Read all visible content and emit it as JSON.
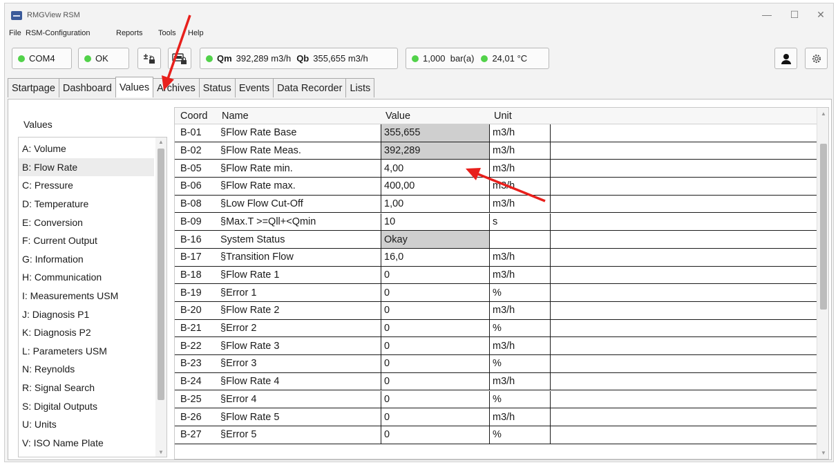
{
  "window": {
    "title": "RMGView RSM"
  },
  "menu": [
    "File",
    "RSM-Configuration",
    "Reports",
    "Tools",
    "Help"
  ],
  "toolbar": {
    "port": "COM4",
    "status": "OK",
    "qm_label": "Qm",
    "qm_value": "392,289 m3/h",
    "qb_label": "Qb",
    "qb_value": "355,655 m3/h",
    "pressure": "1,000  bar(a)",
    "temperature": "24,01 °C",
    "status_color": "#52d24a"
  },
  "tabs": [
    "Startpage",
    "Dashboard",
    "Values",
    "Archives",
    "Status",
    "Events",
    "Data Recorder",
    "Lists"
  ],
  "active_tab": "Values",
  "sidebar": {
    "title": "Values",
    "selected": "B: Flow Rate",
    "items": [
      "A: Volume",
      "B: Flow Rate",
      "C: Pressure",
      "D: Temperature",
      "E: Conversion",
      "F: Current Output",
      "G: Information",
      "H: Communication",
      "I: Measurements USM",
      "J: Diagnosis P1",
      "K: Diagnosis P2",
      "L: Parameters USM",
      "N: Reynolds",
      "R: Signal Search",
      "S: Digital Outputs",
      "U: Units",
      "V: ISO Name Plate"
    ]
  },
  "table": {
    "headers": {
      "coord": "Coord",
      "name": "Name",
      "value": "Value",
      "unit": "Unit"
    },
    "rows": [
      {
        "coord": "B-01",
        "name": "§Flow Rate Base",
        "value": "355,655",
        "unit": "m3/h",
        "readonly": true
      },
      {
        "coord": "B-02",
        "name": "§Flow Rate Meas.",
        "value": "392,289",
        "unit": "m3/h",
        "readonly": true
      },
      {
        "coord": "B-05",
        "name": "§Flow Rate min.",
        "value": "4,00",
        "unit": "m3/h",
        "readonly": false
      },
      {
        "coord": "B-06",
        "name": "§Flow Rate max.",
        "value": "400,00",
        "unit": "m3/h",
        "readonly": false
      },
      {
        "coord": "B-08",
        "name": "§Low Flow Cut-Off",
        "value": "1,00",
        "unit": "m3/h",
        "readonly": false
      },
      {
        "coord": "B-09",
        "name": "§Max.T >=Qll+<Qmin",
        "value": "10",
        "unit": "s",
        "readonly": false
      },
      {
        "coord": "B-16",
        "name": "System Status",
        "value": "Okay",
        "unit": "",
        "readonly": true
      },
      {
        "coord": "B-17",
        "name": "§Transition Flow",
        "value": "16,0",
        "unit": "m3/h",
        "readonly": false
      },
      {
        "coord": "B-18",
        "name": "§Flow Rate 1",
        "value": "0",
        "unit": "m3/h",
        "readonly": false
      },
      {
        "coord": "B-19",
        "name": "§Error 1",
        "value": "0",
        "unit": "%",
        "readonly": false
      },
      {
        "coord": "B-20",
        "name": "§Flow Rate 2",
        "value": "0",
        "unit": "m3/h",
        "readonly": false
      },
      {
        "coord": "B-21",
        "name": "§Error 2",
        "value": "0",
        "unit": "%",
        "readonly": false
      },
      {
        "coord": "B-22",
        "name": "§Flow Rate 3",
        "value": "0",
        "unit": "m3/h",
        "readonly": false
      },
      {
        "coord": "B-23",
        "name": "§Error 3",
        "value": "0",
        "unit": "%",
        "readonly": false
      },
      {
        "coord": "B-24",
        "name": "§Flow Rate 4",
        "value": "0",
        "unit": "m3/h",
        "readonly": false
      },
      {
        "coord": "B-25",
        "name": "§Error 4",
        "value": "0",
        "unit": "%",
        "readonly": false
      },
      {
        "coord": "B-26",
        "name": "§Flow Rate 5",
        "value": "0",
        "unit": "m3/h",
        "readonly": false
      },
      {
        "coord": "B-27",
        "name": "§Error 5",
        "value": "0",
        "unit": "%",
        "readonly": false
      }
    ]
  },
  "colors": {
    "readonly_cell": "#cfcfcf",
    "annotation_arrow": "#e8201c"
  }
}
